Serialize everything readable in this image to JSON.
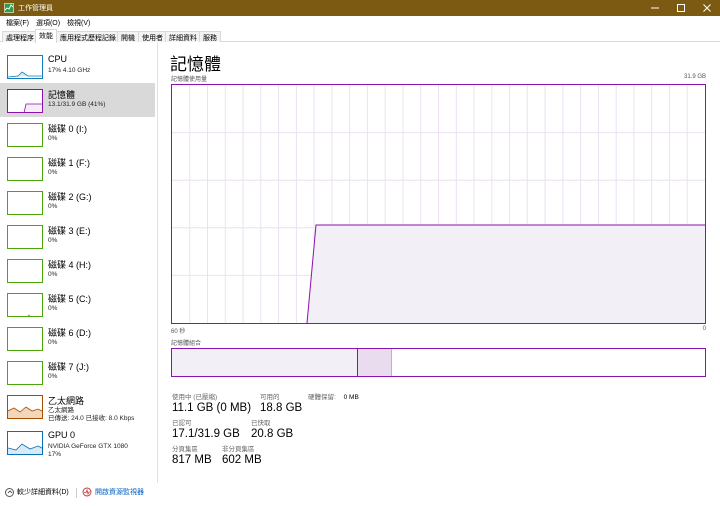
{
  "window": {
    "title": "工作管理員"
  },
  "menu": [
    "檔案(F)",
    "選項(O)",
    "檢視(V)"
  ],
  "tabs": [
    "處理程序",
    "效能",
    "應用程式歷程記錄",
    "開機",
    "使用者",
    "詳細資料",
    "服務"
  ],
  "sidebar": {
    "cpu": {
      "name": "CPU",
      "sub": "17%  4.10 GHz"
    },
    "memory": {
      "name": "記憶體",
      "sub": "13.1/31.9 GB (41%)"
    },
    "disks": [
      {
        "name": "磁碟 0 (I:)",
        "sub": "0%"
      },
      {
        "name": "磁碟 1 (F:)",
        "sub": "0%"
      },
      {
        "name": "磁碟 2 (G:)",
        "sub": "0%"
      },
      {
        "name": "磁碟 3 (E:)",
        "sub": "0%"
      },
      {
        "name": "磁碟 4 (H:)",
        "sub": "0%"
      },
      {
        "name": "磁碟 5 (C:)",
        "sub": "0%"
      },
      {
        "name": "磁碟 6 (D:)",
        "sub": "0%"
      },
      {
        "name": "磁碟 7 (J:)",
        "sub": "0%"
      }
    ],
    "ethernet": {
      "name": "乙太網路",
      "sub1": "乙太網路",
      "sub2": "已傳送: 24.0  已接收: 8.0 Kbps"
    },
    "gpu": {
      "name": "GPU 0",
      "sub1": "NVIDIA GeForce GTX 1080",
      "sub2": "17%"
    }
  },
  "main": {
    "title": "記憶體",
    "usage_label": "記憶體使用量",
    "capacity": "31.9 GB",
    "time_left": "60 秒",
    "time_right": "0",
    "composition_label": "記憶體組合",
    "stats": {
      "in_use_label": "使用中 (已壓縮)",
      "in_use": "11.1 GB (0 MB)",
      "available_label": "可用的",
      "available": "18.8 GB",
      "hw_reserved_label": "硬體保留:",
      "hw_reserved": "0 MB",
      "committed_label": "已認可",
      "committed": "17.1/31.9 GB",
      "cached_label": "已快取",
      "cached": "20.8 GB",
      "paged_label": "分頁集區",
      "paged": "817 MB",
      "nonpaged_label": "非分頁集區",
      "nonpaged": "602 MB"
    }
  },
  "footer": {
    "fewer_details": "較少詳細資料(D)",
    "resource_monitor": "開啟資源監視器"
  },
  "colors": {
    "titlebar": "#7d5a12",
    "memory": "#8b12ae",
    "cpu": "#117dbb",
    "disk": "#4da60c",
    "ethernet": "#a74f01"
  },
  "icons": [
    "task-manager-icon",
    "minimize-icon",
    "maximize-icon",
    "close-icon",
    "chevron-up-icon",
    "resource-monitor-icon"
  ]
}
